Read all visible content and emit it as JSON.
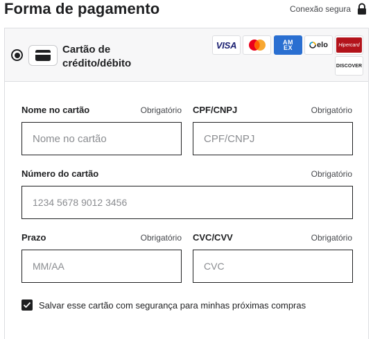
{
  "header": {
    "title": "Forma de pagamento",
    "secure_text": "Conexão segura"
  },
  "payment_option": {
    "label_line1": "Cartão de",
    "label_line2": "crédito/débito",
    "selected": true
  },
  "brands": {
    "visa": "VISA",
    "amex_line1": "AM",
    "amex_line2": "EX",
    "elo": "elo",
    "hipercard": "Hipercard",
    "discover": "DISCOVER"
  },
  "form": {
    "required_text": "Obrigatório",
    "card_name": {
      "label": "Nome no cartão",
      "placeholder": "Nome no cartão",
      "value": ""
    },
    "cpf": {
      "label": "CPF/CNPJ",
      "placeholder": "CPF/CNPJ",
      "value": ""
    },
    "card_number": {
      "label": "Número do cartão",
      "placeholder": "1234 5678 9012 3456",
      "value": ""
    },
    "expiry": {
      "label": "Prazo",
      "placeholder": "MM/AA",
      "value": ""
    },
    "cvc": {
      "label": "CVC/CVV",
      "placeholder": "CVC",
      "value": ""
    },
    "save_card": {
      "label": "Salvar esse cartão com segurança para minhas próximas compras",
      "checked": true
    }
  },
  "colors": {
    "text": "#1e1f21",
    "border": "#dcdde0",
    "option_bg": "#f7f7f8",
    "amex": "#2a6fd1",
    "hipercard": "#b3131b",
    "mastercard_red": "#eb001b",
    "mastercard_orange": "#f79e1b"
  }
}
